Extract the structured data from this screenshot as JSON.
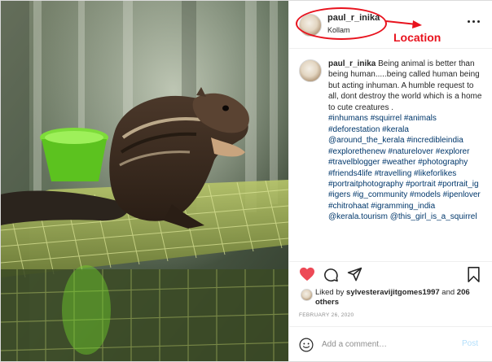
{
  "post": {
    "username": "paul_r_inika",
    "location": "Kollam",
    "more_icon": "more-horizontal-icon",
    "image_alt": "squirrel eating on a wire cage"
  },
  "annotation": {
    "label": "Location",
    "color": "#e8131e"
  },
  "caption": {
    "username": "paul_r_inika",
    "text": "Being animal is better than being human.....being called human being but acting inhuman. A humble request to all, dont destroy the world which is a home to cute creatures .",
    "hashtags": "#inhumans #squirrel #animals #deforestation #kerala @around_the_kerala #incredibleindia #explorethenew #naturelover #explorer #travelblogger #weather #photography #friends4life #travelling #likeforlikes #portraitphotography #portrait #portrait_ig #igers #ig_community #models #ipenlover #chitrohaat #igramming_india @kerala.tourism @this_girl_is_a_squirrel"
  },
  "actions": {
    "like_icon": "heart-filled-icon",
    "comment_icon": "comment-bubble-icon",
    "share_icon": "paper-plane-icon",
    "save_icon": "bookmark-icon",
    "like_color": "#ed4956"
  },
  "likes": {
    "prefix": "Liked by ",
    "user": "sylvesteravijitgomes1997",
    "middle": " and ",
    "others": "206 others"
  },
  "date": "FEBRUARY 26, 2020",
  "comment": {
    "placeholder": "Add a comment…",
    "post_label": "Post",
    "emoji_icon": "smiley-icon"
  },
  "colors": {
    "text": "#262626",
    "link": "#00376b",
    "muted": "#8e8e8e",
    "post_button": "#b2dffc"
  }
}
